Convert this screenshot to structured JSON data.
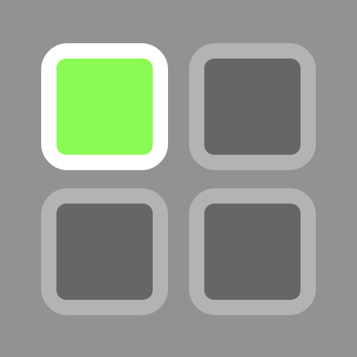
{
  "colors": {
    "background": "#929292",
    "selected_border": "#ffffff",
    "selected_fill": "#8afa54",
    "idle_border": "#b3b3b3",
    "idle_fill": "#666666"
  },
  "grid": {
    "tiles": [
      {
        "icon": "square-selected-icon",
        "selected": true
      },
      {
        "icon": "square-icon",
        "selected": false
      },
      {
        "icon": "square-icon",
        "selected": false
      },
      {
        "icon": "square-icon",
        "selected": false
      }
    ]
  }
}
